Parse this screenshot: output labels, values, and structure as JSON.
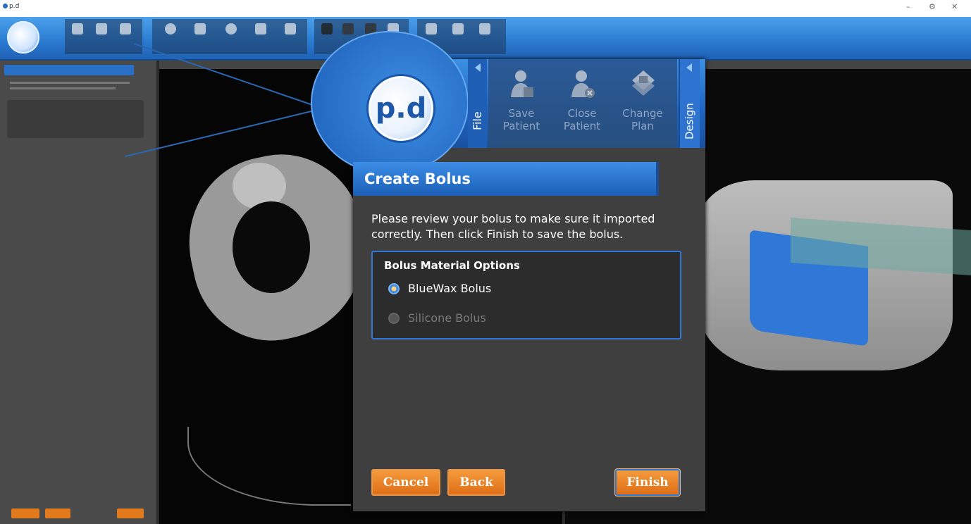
{
  "window": {
    "title": "p.d",
    "controls": [
      "–",
      "⚙",
      "✕"
    ]
  },
  "ribbon": {
    "logo": "p.d"
  },
  "zoom_ribbon": {
    "logo": "p.d",
    "file_tab": "File",
    "design_tab": "Design",
    "tools": [
      {
        "line1": "Save",
        "line2": "Patient",
        "icon": "save-patient-icon"
      },
      {
        "line1": "Close",
        "line2": "Patient",
        "icon": "close-patient-icon"
      },
      {
        "line1": "Change",
        "line2": "Plan",
        "icon": "change-plan-icon"
      }
    ]
  },
  "panel": {
    "title": "Create Bolus",
    "description_line1": "Please review your bolus to make sure it imported",
    "description_line2": "correctly. Then click Finish to save the bolus.",
    "options_title": "Bolus Material Options",
    "options": [
      {
        "label": "BlueWax Bolus",
        "selected": true
      },
      {
        "label": "Silicone Bolus",
        "selected": false
      }
    ],
    "buttons": {
      "cancel": "Cancel",
      "back": "Back",
      "finish": "Finish"
    }
  },
  "colors": {
    "ribbon_blue": "#2b7dd3",
    "accent_orange": "#de6e17",
    "bolus_blue": "#2f78d8",
    "panel_bg": "#3f3f3f"
  }
}
